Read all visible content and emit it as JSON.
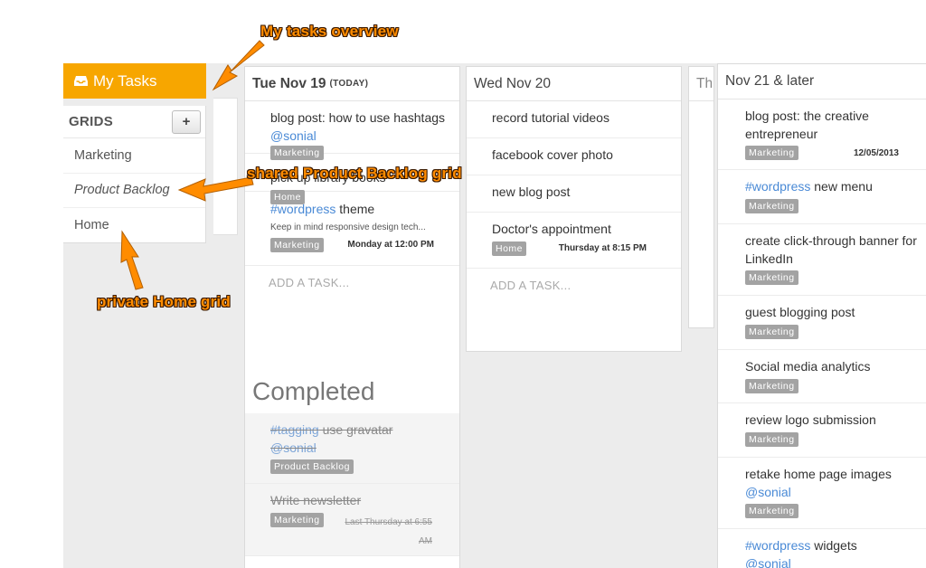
{
  "annotations": {
    "overview": "My tasks overview",
    "shared": "shared Product Backlog grid",
    "private": "private Home grid"
  },
  "sidebar": {
    "my_tasks_label": "My Tasks",
    "grids_label": "GRIDS",
    "add_button": "+",
    "items": [
      {
        "label": "Marketing"
      },
      {
        "label": "Product Backlog"
      },
      {
        "label": "Home"
      }
    ]
  },
  "columns": {
    "tue": {
      "title": "Tue Nov 19",
      "badge": "(TODAY)",
      "tasks": [
        {
          "title": "blog post: how to use hashtags ",
          "mention": "@sonial",
          "tag": "Marketing"
        },
        {
          "title": "pick up library books",
          "tag": "Home"
        },
        {
          "hashtag": "#wordpress",
          "title": " theme",
          "note": "Keep in mind responsive design tech...",
          "tag": "Marketing",
          "date": "Monday at 12:00 PM"
        }
      ],
      "add_task": "ADD A TASK...",
      "completed_label": "Completed",
      "completed": [
        {
          "hashtag": "#tagging",
          "title": " use gravatar",
          "mention": "@sonial",
          "tag": "Product Backlog"
        },
        {
          "title": "Write newsletter",
          "tag": "Marketing",
          "date_line1": "Last Thursday at 6:55",
          "date_line2": "AM"
        }
      ]
    },
    "wed": {
      "title": "Wed Nov 20",
      "tasks": [
        {
          "title": "record tutorial videos"
        },
        {
          "title": "facebook cover photo"
        },
        {
          "title": "new blog post"
        },
        {
          "title": "Doctor's appointment",
          "tag": "Home",
          "date": "Thursday at 8:15 PM"
        }
      ],
      "add_task": "ADD A TASK..."
    },
    "thu": {
      "title": "Th"
    },
    "later": {
      "title": "Nov 21 & later",
      "tasks": [
        {
          "title": "blog post: the creative entrepreneur",
          "tag": "Marketing",
          "date": "12/05/2013"
        },
        {
          "hashtag": "#wordpress",
          "title": " new menu",
          "tag": "Marketing"
        },
        {
          "title": "create click-through banner for LinkedIn",
          "tag": "Marketing"
        },
        {
          "title": "guest blogging post",
          "tag": "Marketing"
        },
        {
          "title": "Social media analytics",
          "tag": "Marketing"
        },
        {
          "title": "review logo submission",
          "tag": "Marketing"
        },
        {
          "title": "retake home page images",
          "mention": "@sonial",
          "tag": "Marketing"
        },
        {
          "hashtag": "#wordpress",
          "title": " widgets",
          "mention": "@sonial"
        }
      ]
    }
  },
  "colors": {
    "accent": "#f7a600",
    "hashtag": "#4a8ad6",
    "annotation": "#ff8c00"
  }
}
